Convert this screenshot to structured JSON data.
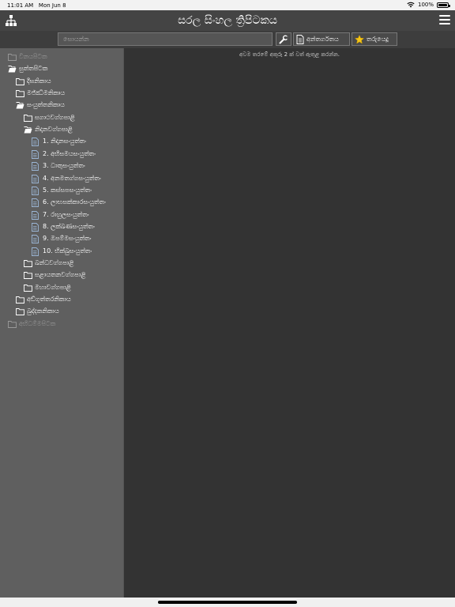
{
  "status_bar": {
    "time": "11:01 AM",
    "date": "Mon Jun 8",
    "battery": "100%",
    "battery_level": 1.0
  },
  "header": {
    "title": "සරල සිංහල ත්‍රිපිටකය"
  },
  "toolbar": {
    "search_placeholder": "සොයන්න",
    "contents_label": "අන්තර්ගතය",
    "bookmarks_label": "තරුයෙදූ"
  },
  "main": {
    "hint": "අවම තරමේ අකුරු 2 ක් වත් ඇතුළ කරන්න."
  },
  "tree": [
    {
      "label": "විනයපිටක",
      "icon": "folder-closed-icon",
      "dim": true
    },
    {
      "label": "සුත්තපිටක",
      "icon": "folder-open-icon",
      "dim": false
    },
    {
      "label": "දීඝනිකාය",
      "icon": "folder-closed-icon",
      "dim": false
    },
    {
      "label": "මජ්ඣිමනිකාය",
      "icon": "folder-closed-icon",
      "dim": false
    },
    {
      "label": "සංයුත්තනිකාය",
      "icon": "folder-open-icon",
      "dim": false
    },
    {
      "label": "සගාථවග්ගපාළි",
      "icon": "folder-closed-icon",
      "dim": false
    },
    {
      "label": "නිදානවග්ගපාළි",
      "icon": "folder-open-icon",
      "dim": false
    },
    {
      "label": "1. නිදානසංයුත්තං",
      "icon": "document-icon",
      "dim": false
    },
    {
      "label": "2. අභිසමයසංයුත්තං",
      "icon": "document-icon",
      "dim": false
    },
    {
      "label": "3. ධාතුසංයුත්තං",
      "icon": "document-icon",
      "dim": false
    },
    {
      "label": "4. අනමතග්ගසංයුත්තං",
      "icon": "document-icon",
      "dim": false
    },
    {
      "label": "5. කස්සපසංයුත්තං",
      "icon": "document-icon",
      "dim": false
    },
    {
      "label": "6. ලාභසක්කාරසංයුත්තං",
      "icon": "document-icon",
      "dim": false
    },
    {
      "label": "7. රාහුලසංයුත්තං",
      "icon": "document-icon",
      "dim": false
    },
    {
      "label": "8. ලක්ඛණසංයුත්තං",
      "icon": "document-icon",
      "dim": false
    },
    {
      "label": "9. ඔපම්මසංයුත්තං",
      "icon": "document-icon",
      "dim": false
    },
    {
      "label": "10. භික්ඛුසංයුත්තං",
      "icon": "document-icon",
      "dim": false
    },
    {
      "label": "ඛන්ධවග්ගපාළි",
      "icon": "folder-closed-icon",
      "dim": false
    },
    {
      "label": "සළායතනවග්ගපාළි",
      "icon": "folder-closed-icon",
      "dim": false
    },
    {
      "label": "මහාවග්ගපාළි",
      "icon": "folder-closed-icon",
      "dim": false
    },
    {
      "label": "අඞ්ගුත්තරනිකාය",
      "icon": "folder-closed-icon",
      "dim": false
    },
    {
      "label": "ඛුද්දකනිකාය",
      "icon": "folder-closed-icon",
      "dim": false
    },
    {
      "label": "අභිධම්මපිටක",
      "icon": "folder-closed-icon",
      "dim": true
    }
  ]
}
